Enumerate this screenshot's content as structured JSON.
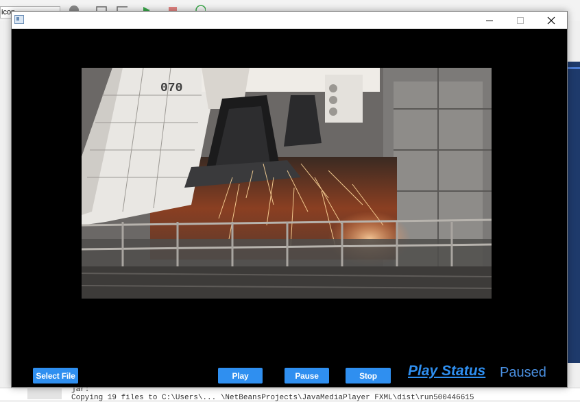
{
  "background": {
    "toolbar_field_text": "icon",
    "console_line1": "jar:",
    "console_line2": "Copying 19 files to C:\\Users\\... \\NetBeansProjects\\JavaMediaPlayer FXML\\dist\\run500446615"
  },
  "window": {
    "title": ""
  },
  "video": {
    "overlay_text": "070"
  },
  "controls": {
    "select_file": "Select File",
    "play": "Play",
    "pause": "Pause",
    "stop": "Stop"
  },
  "status": {
    "label": "Play Status",
    "value": "Paused"
  },
  "colors": {
    "accent": "#2f8ff0",
    "window_bg": "#000000"
  }
}
